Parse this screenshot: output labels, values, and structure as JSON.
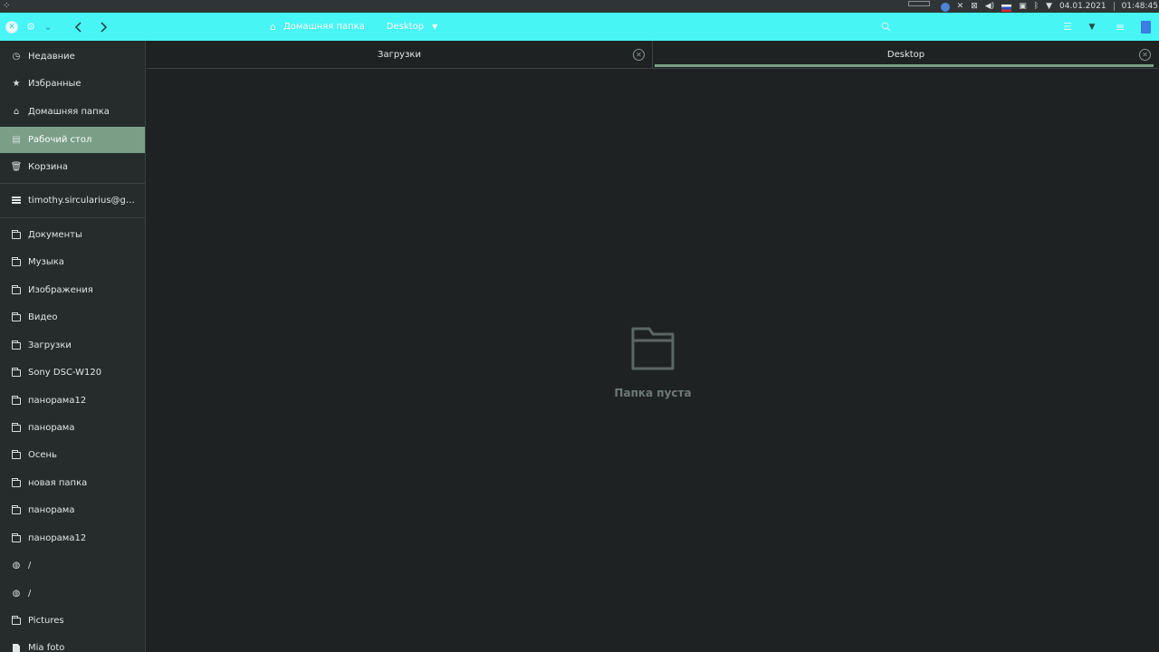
{
  "system_panel": {
    "menu_glyph": "⁘",
    "date": "04.01.2021",
    "time": "01:48:45"
  },
  "header": {
    "breadcrumb": [
      "Домашняя папка",
      "Desktop"
    ]
  },
  "sidebar": {
    "items": [
      {
        "label": "Недавние",
        "icon": "clock-icon"
      },
      {
        "label": "Избранные",
        "icon": "star-icon"
      },
      {
        "label": "Домашняя папка",
        "icon": "home-icon"
      },
      {
        "label": "Рабочий стол",
        "icon": "desktop-icon",
        "active": true
      },
      {
        "label": "Корзина",
        "icon": "trash-icon"
      },
      {
        "label": "timothy.sircularius@gma...",
        "icon": "drive-icon"
      },
      {
        "label": "Документы",
        "icon": "folder-icon"
      },
      {
        "label": "Музыка",
        "icon": "folder-icon"
      },
      {
        "label": "Изображения",
        "icon": "folder-icon"
      },
      {
        "label": "Видео",
        "icon": "folder-icon"
      },
      {
        "label": "Загрузки",
        "icon": "folder-icon"
      },
      {
        "label": "Sony DSC-W120",
        "icon": "folder-icon"
      },
      {
        "label": "панорама12",
        "icon": "folder-icon"
      },
      {
        "label": "панорама",
        "icon": "folder-icon"
      },
      {
        "label": "Осень",
        "icon": "folder-icon"
      },
      {
        "label": "новая папка",
        "icon": "folder-icon"
      },
      {
        "label": "панорама",
        "icon": "folder-icon"
      },
      {
        "label": "панорама12",
        "icon": "folder-icon"
      },
      {
        "label": "/",
        "icon": "globe-icon"
      },
      {
        "label": "/",
        "icon": "globe-icon"
      },
      {
        "label": "Pictures",
        "icon": "folder-icon"
      },
      {
        "label": "Mia foto",
        "icon": "file-icon"
      }
    ]
  },
  "tabs": [
    {
      "label": "Загрузки",
      "active": false
    },
    {
      "label": "Desktop",
      "active": true
    }
  ],
  "content": {
    "empty_message": "Папка пуста"
  },
  "colors": {
    "accent": "#47f5f5",
    "active_item": "#7b9f86",
    "background": "#1e2222",
    "sidebar": "#262b2c"
  }
}
